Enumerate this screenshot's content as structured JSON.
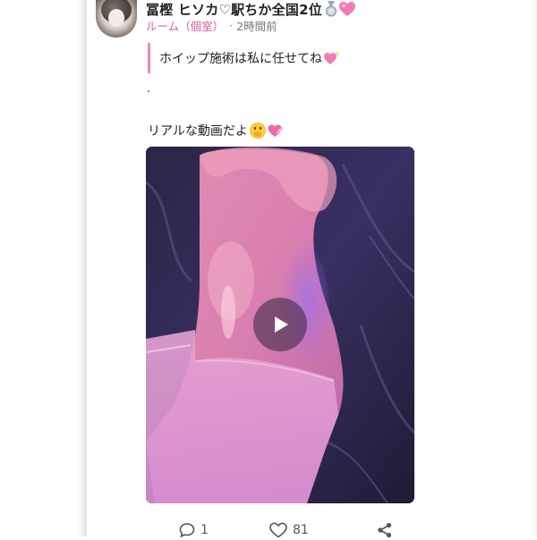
{
  "post": {
    "author_name": "冨樫 ヒソカ♡駅ちか全国2位",
    "room_link": "ルーム（個室）",
    "meta_separator": "·",
    "time_ago": "2時間前",
    "quote_text": "ホイップ施術は私に任せてね",
    "dot_line": ".",
    "caption_text": "リアルな動画だよ"
  },
  "badges": {
    "medal": "silver-medal-icon",
    "heart": "pink-heart-icon",
    "quote_emoji": "sparkling-heart-icon",
    "caption_emoji_1": "face-with-hand-over-mouth-icon",
    "caption_emoji_2": "heart-with-ribbon-icon"
  },
  "video": {
    "play_icon": "play-icon"
  },
  "actions": {
    "comment_count": "1",
    "like_count": "81",
    "share_icon": "share-icon"
  },
  "colors": {
    "accent": "#d35e9c",
    "quote_border": "#e58ab9"
  }
}
